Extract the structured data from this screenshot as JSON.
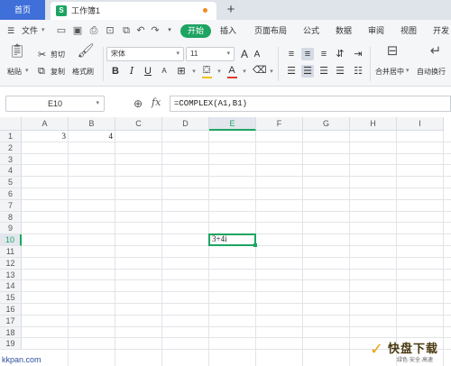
{
  "tabbar": {
    "home_label": "首页",
    "doc_title": "工作簿1",
    "doc_icon": "S",
    "add_label": "+"
  },
  "menu": {
    "file_label": "文件",
    "items": [
      "开始",
      "插入",
      "页面布局",
      "公式",
      "数据",
      "审阅",
      "视图",
      "开发"
    ]
  },
  "ribbon": {
    "paste_label": "粘贴",
    "cut_label": "剪切",
    "copy_label": "复制",
    "format_painter_label": "格式刷",
    "font_name": "宋体",
    "font_size": "11",
    "merge_label": "合并居中",
    "wrap_label": "自动换行",
    "font_color": "#e03b30",
    "fill_color": "#f2c21c"
  },
  "formula_bar": {
    "name_box": "E10",
    "fx_label": "fx",
    "formula": "=COMPLEX(A1,B1)"
  },
  "grid": {
    "columns": [
      "A",
      "B",
      "C",
      "D",
      "E",
      "F",
      "G",
      "H",
      "I"
    ],
    "rows": [
      "1",
      "2",
      "3",
      "4",
      "5",
      "6",
      "7",
      "8",
      "9",
      "10",
      "11",
      "12",
      "13",
      "14",
      "15",
      "16",
      "17",
      "18",
      "19"
    ],
    "selected_column": "E",
    "selected_row": "10",
    "cells": {
      "A1": "3",
      "B1": "4",
      "E10": "3+4i"
    }
  },
  "watermark": {
    "site": "kkpan.com",
    "brand": "快盘下载",
    "brand_mark": "K",
    "tagline": "绿色·安全·高速"
  },
  "colors": {
    "accent": "#1da462",
    "home_tab": "#3f6fd8"
  }
}
